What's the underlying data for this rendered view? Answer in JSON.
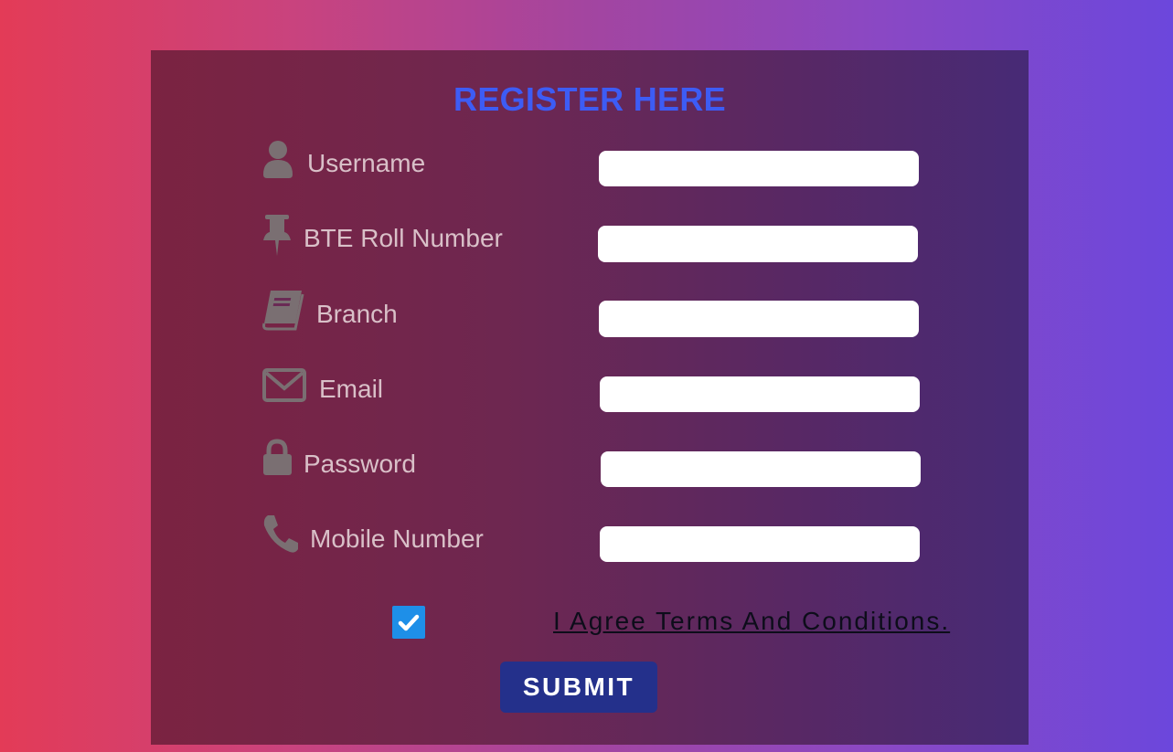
{
  "form": {
    "title": "REGISTER HERE",
    "fields": [
      {
        "label": "Username",
        "icon": "user-icon",
        "value": ""
      },
      {
        "label": "BTE Roll Number",
        "icon": "pushpin-icon",
        "value": ""
      },
      {
        "label": "Branch",
        "icon": "book-icon",
        "value": ""
      },
      {
        "label": "Email",
        "icon": "envelope-icon",
        "value": ""
      },
      {
        "label": "Password",
        "icon": "lock-icon",
        "value": ""
      },
      {
        "label": "Mobile Number",
        "icon": "phone-icon",
        "value": ""
      }
    ],
    "agree": {
      "label": "I Agree Terms And Conditions.",
      "checked": true
    },
    "submit_label": "SUBMIT"
  },
  "colors": {
    "title": "#3d5cf5",
    "label": "#d9c0c8",
    "icon": "#7a6f72",
    "submit_bg": "#24308b",
    "checkbox": "#1e8fe8"
  }
}
